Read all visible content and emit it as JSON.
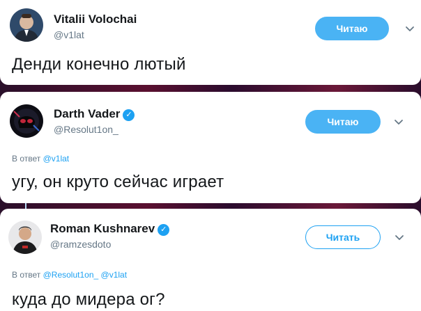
{
  "tweets": [
    {
      "author": "Vitalii Volochai",
      "handle": "@v1lat",
      "verified": false,
      "button_label": "Читаю",
      "button_state": "following",
      "reply_prefix": "",
      "reply_mentions": [],
      "text": "Денди конечно лютый"
    },
    {
      "author": "Darth Vader",
      "handle": "@Resolut1on_",
      "verified": true,
      "button_label": "Читаю",
      "button_state": "following",
      "reply_prefix": "В ответ",
      "reply_mentions": [
        "@v1lat"
      ],
      "text": "угу, он круто сейчас играет"
    },
    {
      "author": "Roman Kushnarev",
      "handle": "@ramzesdoto",
      "verified": true,
      "button_label": "Читать",
      "button_state": "follow",
      "reply_prefix": "В ответ",
      "reply_mentions": [
        "@Resolut1on_",
        "@v1lat"
      ],
      "text": "куда до мидера ог?"
    }
  ],
  "colors": {
    "accent": "#1da1f2",
    "following_bg": "#4ab3f4",
    "muted": "#657786",
    "text": "#14171a"
  },
  "icons": [
    "verified-badge-icon",
    "chevron-down-icon",
    "avatar"
  ]
}
